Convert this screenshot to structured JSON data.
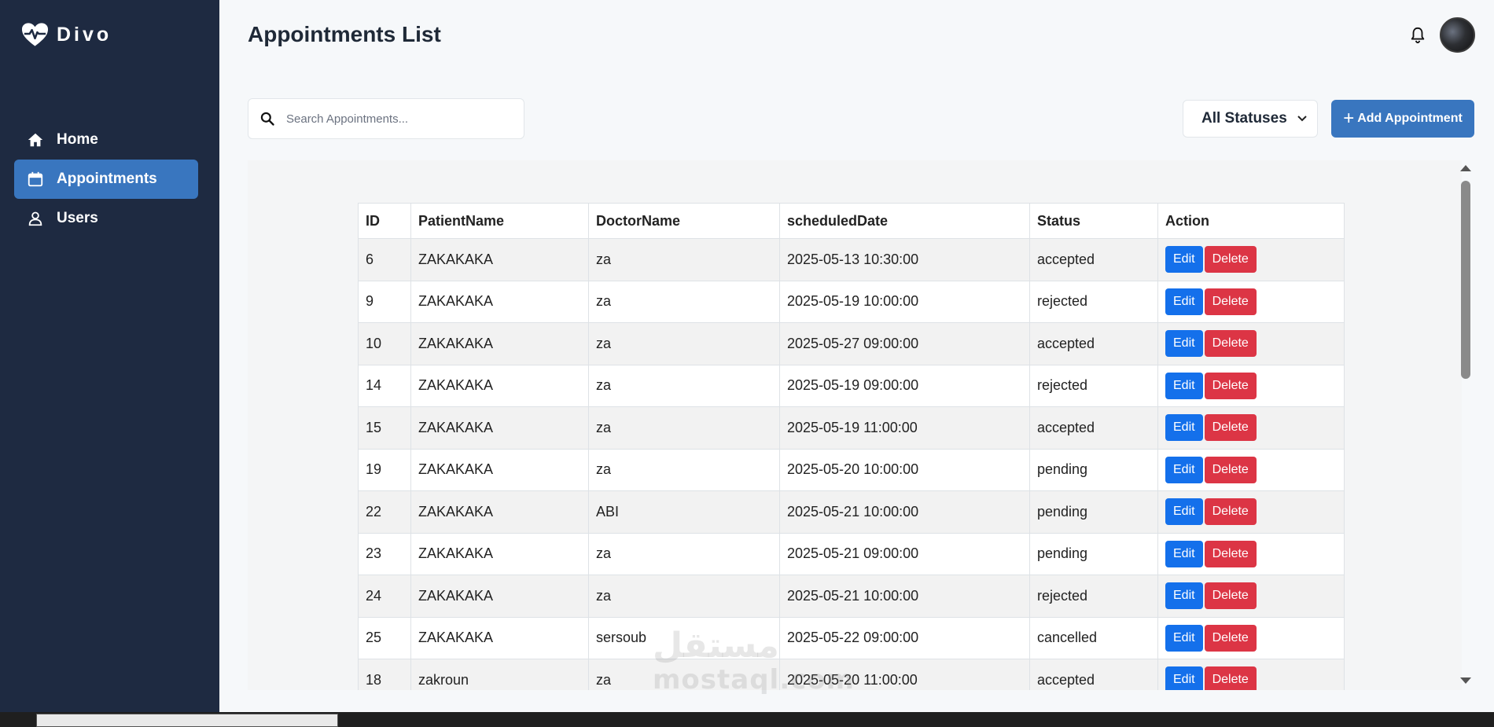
{
  "app": {
    "name": "Divo"
  },
  "sidebar": {
    "items": [
      {
        "label": "Home",
        "icon": "home-icon",
        "active": false
      },
      {
        "label": "Appointments",
        "icon": "calendar-icon",
        "active": true
      },
      {
        "label": "Users",
        "icon": "user-icon",
        "active": false
      }
    ]
  },
  "header": {
    "title": "Appointments List",
    "bell_icon": "bell-icon",
    "avatar_icon": "avatar"
  },
  "search": {
    "placeholder": "Search Appointments..."
  },
  "filter": {
    "selected": "All Statuses",
    "icon": "chevron-down-icon"
  },
  "toolbar": {
    "add_plus": "+",
    "add_label": "Add Appointment"
  },
  "table": {
    "columns": [
      "ID",
      "PatientName",
      "DoctorName",
      "scheduledDate",
      "Status",
      "Action"
    ],
    "rows": [
      {
        "id": "6",
        "patient": "ZAKAKAKA",
        "doctor": "za",
        "date": "2025-05-13 10:30:00",
        "status": "accepted"
      },
      {
        "id": "9",
        "patient": "ZAKAKAKA",
        "doctor": "za",
        "date": "2025-05-19 10:00:00",
        "status": "rejected"
      },
      {
        "id": "10",
        "patient": "ZAKAKAKA",
        "doctor": "za",
        "date": "2025-05-27 09:00:00",
        "status": "accepted"
      },
      {
        "id": "14",
        "patient": "ZAKAKAKA",
        "doctor": "za",
        "date": "2025-05-19 09:00:00",
        "status": "rejected"
      },
      {
        "id": "15",
        "patient": "ZAKAKAKA",
        "doctor": "za",
        "date": "2025-05-19 11:00:00",
        "status": "accepted"
      },
      {
        "id": "19",
        "patient": "ZAKAKAKA",
        "doctor": "za",
        "date": "2025-05-20 10:00:00",
        "status": "pending"
      },
      {
        "id": "22",
        "patient": "ZAKAKAKA",
        "doctor": "ABI",
        "date": "2025-05-21 10:00:00",
        "status": "pending"
      },
      {
        "id": "23",
        "patient": "ZAKAKAKA",
        "doctor": "za",
        "date": "2025-05-21 09:00:00",
        "status": "pending"
      },
      {
        "id": "24",
        "patient": "ZAKAKAKA",
        "doctor": "za",
        "date": "2025-05-21 10:00:00",
        "status": "rejected"
      },
      {
        "id": "25",
        "patient": "ZAKAKAKA",
        "doctor": "sersoub",
        "date": "2025-05-22 09:00:00",
        "status": "cancelled"
      },
      {
        "id": "18",
        "patient": "zakroun",
        "doctor": "za",
        "date": "2025-05-20 11:00:00",
        "status": "accepted"
      }
    ],
    "edit_label": "Edit",
    "delete_label": "Delete"
  },
  "watermark": {
    "arabic": "مستقل",
    "latin": "mostaql.com"
  },
  "colors": {
    "sidebar_bg": "#1e2a41",
    "accent": "#3976bf",
    "edit": "#1470eb",
    "delete": "#dc3545"
  }
}
